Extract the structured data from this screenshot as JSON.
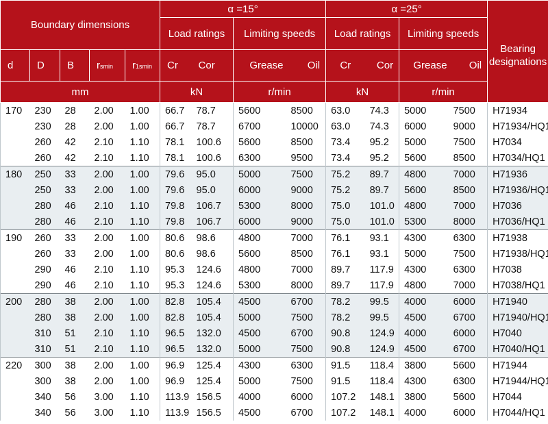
{
  "header": {
    "boundary": "Boundary dimensions",
    "alpha15": "α =15°",
    "alpha25": "α =25°",
    "load_ratings": "Load ratings",
    "limiting_speeds": "Limiting speeds",
    "bearing_designations": "Bearing designations",
    "col_d": "d",
    "col_D": "D",
    "col_B": "B",
    "col_r": "r",
    "col_r_sub": "smin",
    "col_r1": "r",
    "col_r1_sub": "1smin",
    "col_cr": "Cr",
    "col_cor": "Cor",
    "col_grease": "Grease",
    "col_oil": "Oil",
    "unit_mm": "mm",
    "unit_kn": "kN",
    "unit_rmin": "r/min"
  },
  "rows": [
    [
      "170",
      "230",
      "28",
      "2.00",
      "1.00",
      "66.7",
      "78.7",
      "5600",
      "8500",
      "63.0",
      "74.3",
      "5000",
      "7500",
      "H71934"
    ],
    [
      "",
      "230",
      "28",
      "2.00",
      "1.00",
      "66.7",
      "78.7",
      "6700",
      "10000",
      "63.0",
      "74.3",
      "6000",
      "9000",
      "H71934/HQ1"
    ],
    [
      "",
      "260",
      "42",
      "2.10",
      "1.10",
      "78.1",
      "100.6",
      "5600",
      "8500",
      "73.4",
      "95.2",
      "5000",
      "7500",
      "H7034"
    ],
    [
      "",
      "260",
      "42",
      "2.10",
      "1.10",
      "78.1",
      "100.6",
      "6300",
      "9500",
      "73.4",
      "95.2",
      "5600",
      "8500",
      "H7034/HQ1"
    ],
    [
      "180",
      "250",
      "33",
      "2.00",
      "1.00",
      "79.6",
      "95.0",
      "5000",
      "7500",
      "75.2",
      "89.7",
      "4800",
      "7000",
      "H71936"
    ],
    [
      "",
      "250",
      "33",
      "2.00",
      "1.00",
      "79.6",
      "95.0",
      "6000",
      "9000",
      "75.2",
      "89.7",
      "5600",
      "8500",
      "H71936/HQ1"
    ],
    [
      "",
      "280",
      "46",
      "2.10",
      "1.10",
      "79.8",
      "106.7",
      "5300",
      "8000",
      "75.0",
      "101.0",
      "4800",
      "7000",
      "H7036"
    ],
    [
      "",
      "280",
      "46",
      "2.10",
      "1.10",
      "79.8",
      "106.7",
      "6000",
      "9000",
      "75.0",
      "101.0",
      "5300",
      "8000",
      "H7036/HQ1"
    ],
    [
      "190",
      "260",
      "33",
      "2.00",
      "1.00",
      "80.6",
      "98.6",
      "4800",
      "7000",
      "76.1",
      "93.1",
      "4300",
      "6300",
      "H71938"
    ],
    [
      "",
      "260",
      "33",
      "2.00",
      "1.00",
      "80.6",
      "98.6",
      "5600",
      "8500",
      "76.1",
      "93.1",
      "5000",
      "7500",
      "H71938/HQ1"
    ],
    [
      "",
      "290",
      "46",
      "2.10",
      "1.10",
      "95.3",
      "124.6",
      "4800",
      "7000",
      "89.7",
      "117.9",
      "4300",
      "6300",
      "H7038"
    ],
    [
      "",
      "290",
      "46",
      "2.10",
      "1.10",
      "95.3",
      "124.6",
      "5300",
      "8000",
      "89.7",
      "117.9",
      "4800",
      "7000",
      "H7038/HQ1"
    ],
    [
      "200",
      "280",
      "38",
      "2.00",
      "1.00",
      "82.8",
      "105.4",
      "4500",
      "6700",
      "78.2",
      "99.5",
      "4000",
      "6000",
      "H71940"
    ],
    [
      "",
      "280",
      "38",
      "2.00",
      "1.00",
      "82.8",
      "105.4",
      "5000",
      "7500",
      "78.2",
      "99.5",
      "4500",
      "6700",
      "H71940/HQ1"
    ],
    [
      "",
      "310",
      "51",
      "2.10",
      "1.10",
      "96.5",
      "132.0",
      "4500",
      "6700",
      "90.8",
      "124.9",
      "4000",
      "6000",
      "H7040"
    ],
    [
      "",
      "310",
      "51",
      "2.10",
      "1.10",
      "96.5",
      "132.0",
      "5000",
      "7500",
      "90.8",
      "124.9",
      "4500",
      "6700",
      "H7040/HQ1"
    ],
    [
      "220",
      "300",
      "38",
      "2.00",
      "1.00",
      "96.9",
      "125.4",
      "4300",
      "6300",
      "91.5",
      "118.4",
      "3800",
      "5600",
      "H71944"
    ],
    [
      "",
      "300",
      "38",
      "2.00",
      "1.00",
      "96.9",
      "125.4",
      "5000",
      "7500",
      "91.5",
      "118.4",
      "4300",
      "6300",
      "H71944/HQ1"
    ],
    [
      "",
      "340",
      "56",
      "3.00",
      "1.10",
      "113.9",
      "156.5",
      "4000",
      "6000",
      "107.2",
      "148.1",
      "3800",
      "5600",
      "H7044"
    ],
    [
      "",
      "340",
      "56",
      "3.00",
      "1.10",
      "113.9",
      "156.5",
      "4500",
      "6700",
      "107.2",
      "148.1",
      "4000",
      "6000",
      "H7044/HQ1"
    ]
  ]
}
